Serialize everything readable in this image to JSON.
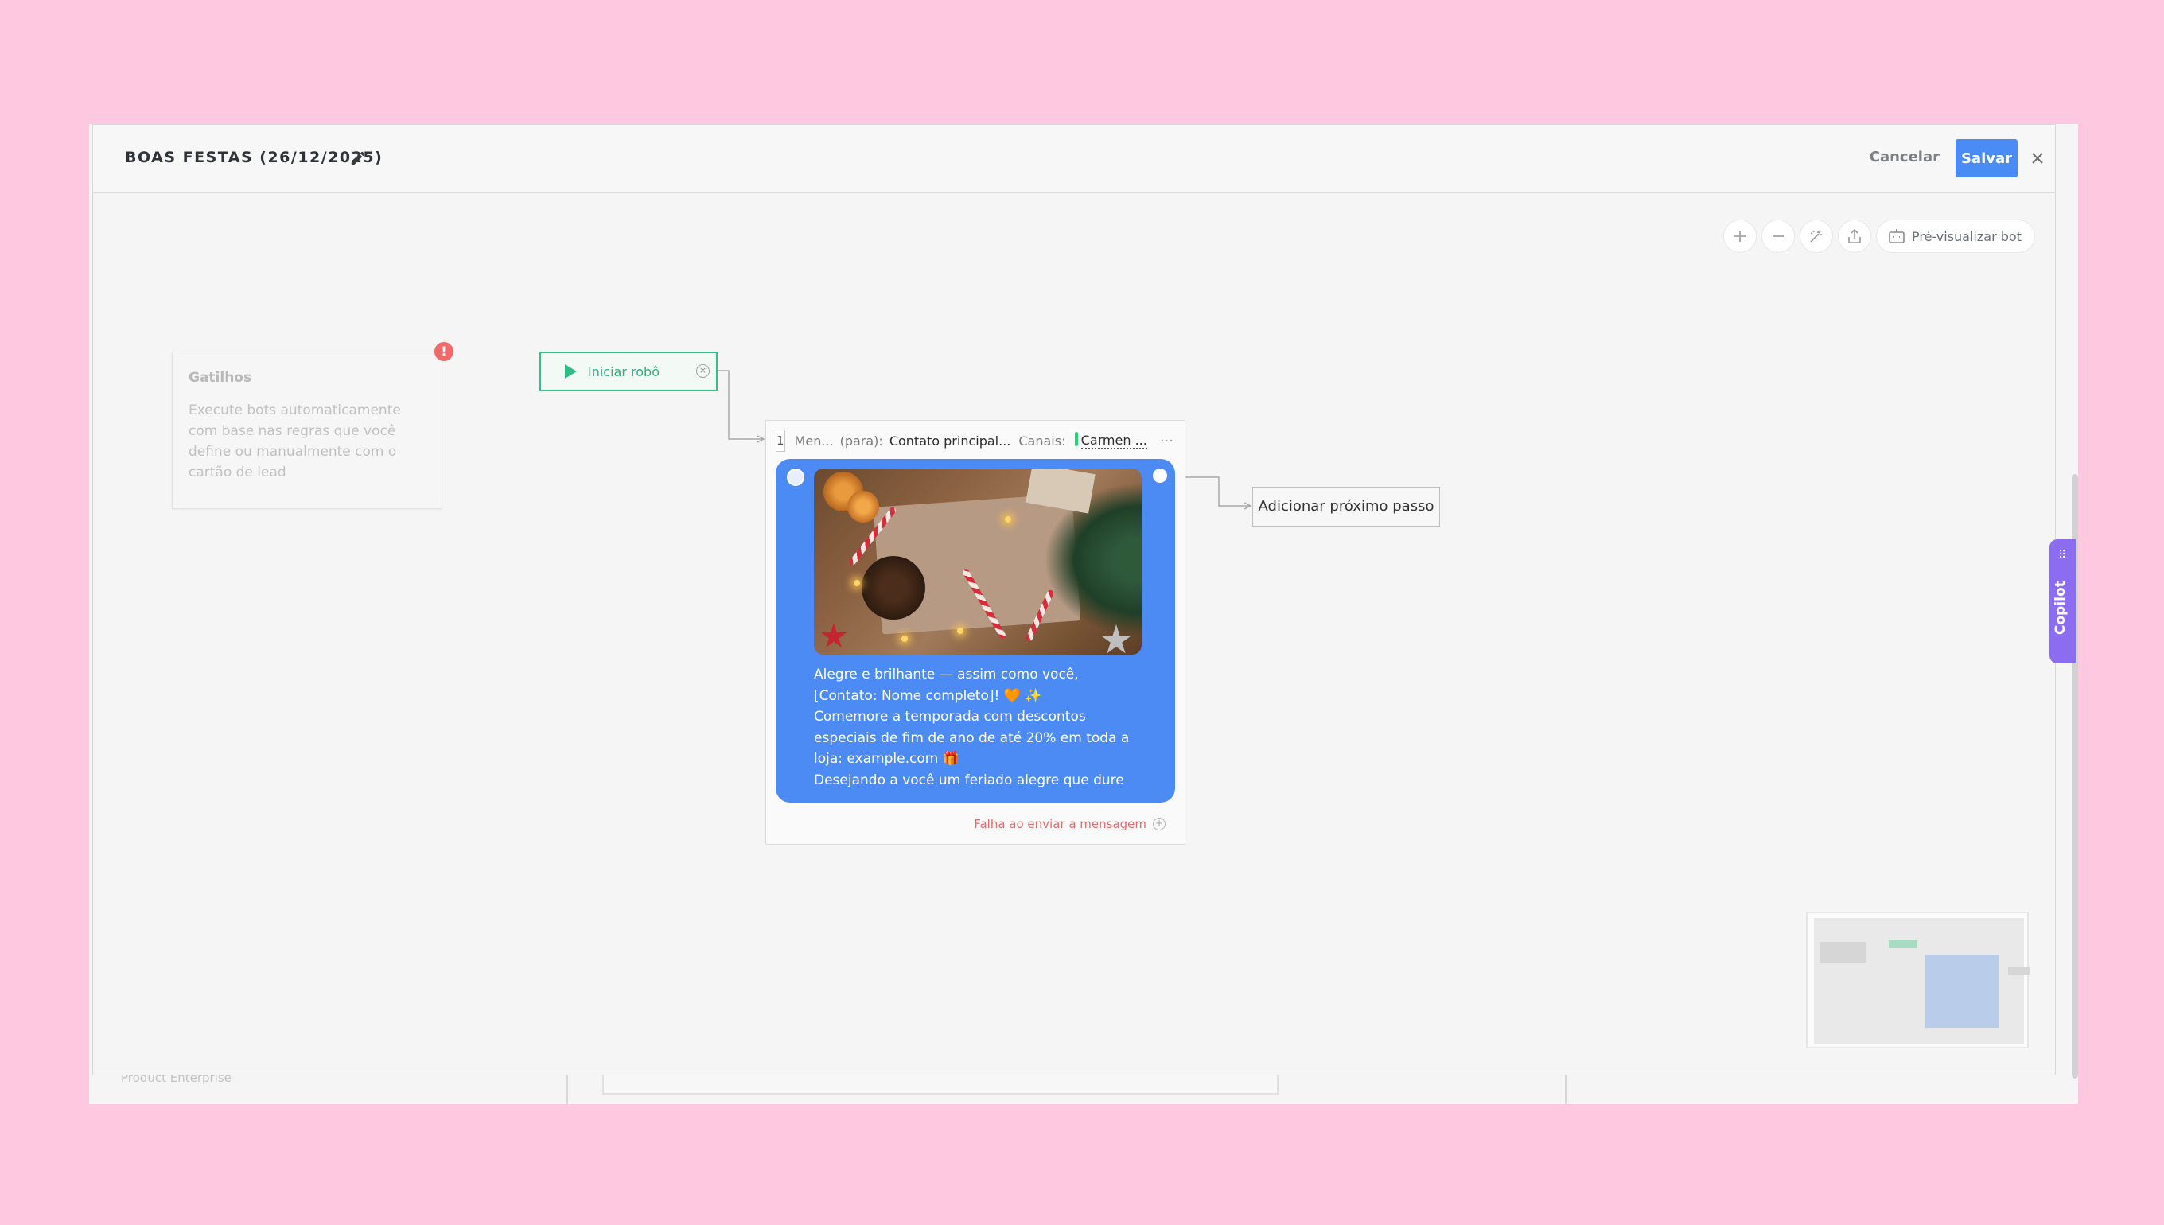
{
  "header": {
    "title": "BOAS FESTAS (26/12/2025)",
    "cancel_label": "Cancelar",
    "save_label": "Salvar"
  },
  "toolbar": {
    "zoom_in_icon": "plus-icon",
    "zoom_out_icon": "minus-icon",
    "magic_icon": "magic-wand-icon",
    "export_icon": "upload-icon",
    "preview_label": "Pré-visualizar bot"
  },
  "triggers": {
    "title": "Gatilhos",
    "description": "Execute bots automaticamente com base nas regras que você define ou manualmente com o cartão de lead",
    "alert": "!"
  },
  "start_node": {
    "label": "Iniciar robô"
  },
  "message_node": {
    "step": "1",
    "type_label": "Men...",
    "to_label": "(para):",
    "to_value": "Contato principal...",
    "channels_label": "Canais:",
    "channel_value": "Carmen ...",
    "more": "···",
    "text_lines": [
      "Alegre e brilhante — assim como você,",
      "[Contato: Nome completo]! 🧡 ✨",
      "Comemore a temporada com descontos",
      "especiais de fim de ano de até 20% em toda a",
      "loja: example.com 🎁",
      "Desejando a você um feriado alegre que dure"
    ],
    "fail_label": "Falha ao enviar a mensagem"
  },
  "next_step": {
    "label": "Adicionar próximo passo"
  },
  "copilot": {
    "label": "Copilot"
  },
  "background": {
    "bottom_text": "Product Enterprise"
  },
  "colors": {
    "accent": "#4a8cf6",
    "start_green": "#33c08a",
    "copilot_purple": "#8c6cf0",
    "error_red": "#ef6a68",
    "page_bg": "#fdc8e0"
  }
}
